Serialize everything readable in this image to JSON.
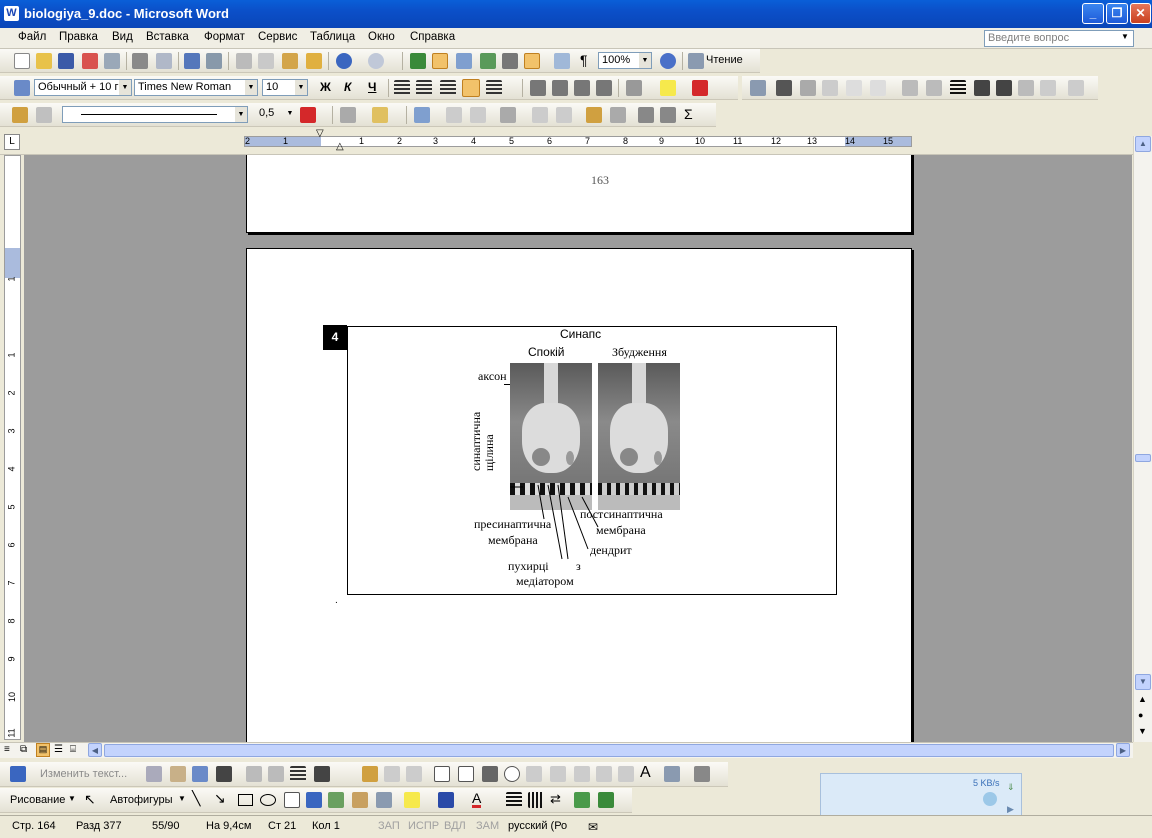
{
  "window": {
    "title": "biologiya_9.doc - Microsoft Word"
  },
  "menu": [
    "Файл",
    "Правка",
    "Вид",
    "Вставка",
    "Формат",
    "Сервис",
    "Таблица",
    "Окно",
    "Справка"
  ],
  "help_box": {
    "placeholder": "Введите вопрос"
  },
  "toolbar_standard": {
    "zoom": "100%",
    "reading_label": "Чтение"
  },
  "toolbar_formatting": {
    "style": "Обычный + 10 г",
    "font": "Times New Roman",
    "size": "10",
    "bold": "Ж",
    "italic": "К",
    "underline": "Ч"
  },
  "toolbar_tables": {
    "line_weight": "0,5"
  },
  "ruler": {
    "h_ticks": [
      "2",
      "1",
      "1",
      "2",
      "3",
      "4",
      "5",
      "6",
      "7",
      "8",
      "9",
      "10",
      "11",
      "12",
      "13",
      "14",
      "15"
    ],
    "v_ticks": [
      "1",
      "1",
      "2",
      "3",
      "4",
      "5",
      "6",
      "7",
      "8",
      "9",
      "10",
      "11"
    ]
  },
  "document": {
    "page_number": "163",
    "figure": {
      "number": "4",
      "title": "Синапс",
      "label_rest": "Спокій",
      "label_excited": "Збудження",
      "axon": "аксон",
      "cleft": "синаптична щілина",
      "presyn_1": "пресинаптична",
      "presyn_2": "мембрана",
      "postsyn_1": "постсинаптична",
      "postsyn_2": "мембрана",
      "dendrite": "дендрит",
      "vesicles_1": "пухирці",
      "vesicles_z": "з",
      "vesicles_2": "медіатором"
    },
    "dot_after": "."
  },
  "drawing_toolbar": {
    "edit_text": "Изменить текст...",
    "draw_label": "Рисование",
    "autoshapes": "Автофигуры"
  },
  "network_widget": {
    "speed": "5 KB/s"
  },
  "status": {
    "page": "Стр.  164",
    "section": "Разд  377",
    "pages": "55/90",
    "at": "На 9,4см",
    "line": "Ст  21",
    "col": "Кол  1",
    "rec": "ЗАП",
    "trk": "ИСПР",
    "ext": "ВДЛ",
    "ovr": "ЗАМ",
    "lang": "русский (Ро"
  }
}
